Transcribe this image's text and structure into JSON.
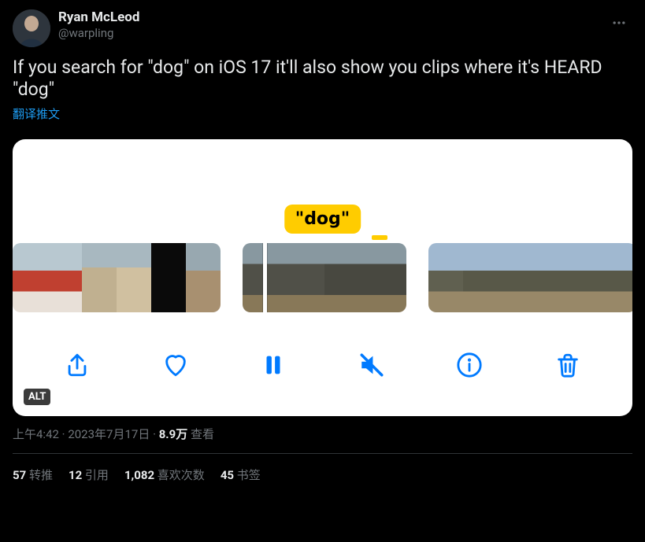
{
  "author": {
    "display_name": "Ryan McLeod",
    "handle": "@warpling"
  },
  "tweet_text": "If you search for \"dog\" on iOS 17 it'll also show you clips where it's HEARD \"dog\"",
  "translate_label": "翻译推文",
  "media": {
    "tooltip": "\"dog\"",
    "alt_label": "ALT",
    "toolbar": {
      "share": "share",
      "like": "like",
      "pause": "pause",
      "mute": "mute",
      "info": "info",
      "delete": "delete"
    }
  },
  "meta": {
    "time": "上午4:42",
    "date": "2023年7月17日",
    "views_count": "8.9万",
    "views_label": "查看"
  },
  "stats": {
    "retweets_count": "57",
    "retweets_label": "转推",
    "quotes_count": "12",
    "quotes_label": "引用",
    "likes_count": "1,082",
    "likes_label": "喜欢次数",
    "bookmarks_count": "45",
    "bookmarks_label": "书签"
  }
}
